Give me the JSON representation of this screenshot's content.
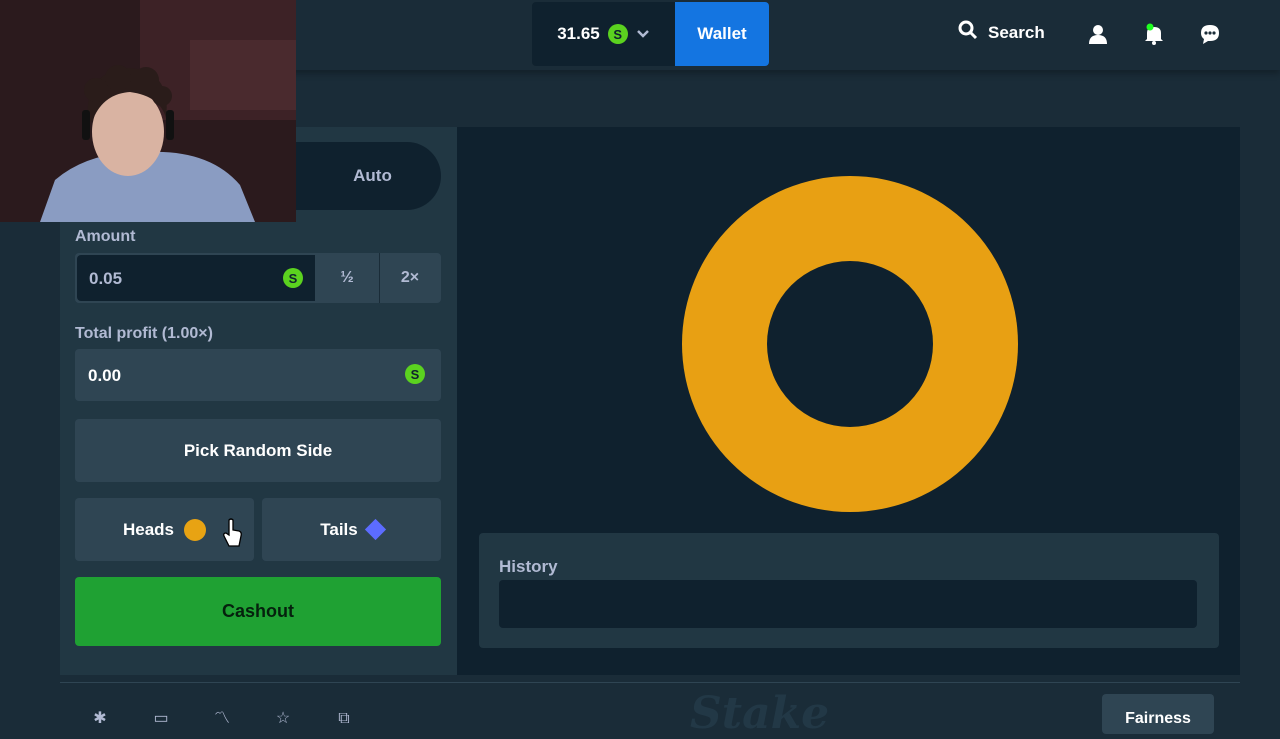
{
  "header": {
    "balance": "31.65",
    "currency_symbol": "S",
    "wallet_label": "Wallet",
    "search_label": "Search"
  },
  "bet_panel": {
    "mode_auto_label": "Auto",
    "amount_label": "Amount",
    "amount_value": "0.05",
    "half_label": "½",
    "double_label": "2×",
    "profit_label": "Total profit (1.00×)",
    "profit_value": "0.00",
    "random_side_label": "Pick Random Side",
    "heads_label": "Heads",
    "tails_label": "Tails",
    "cashout_label": "Cashout"
  },
  "game": {
    "history_label": "History"
  },
  "footer": {
    "brand": "Stake",
    "fairness_label": "Fairness"
  },
  "colors": {
    "accent_blue": "#1475e1",
    "cashout_green": "#1fa133",
    "heads_gold": "#e8a313",
    "tails_blue": "#5c6cff",
    "currency_green": "#5bd21f"
  }
}
